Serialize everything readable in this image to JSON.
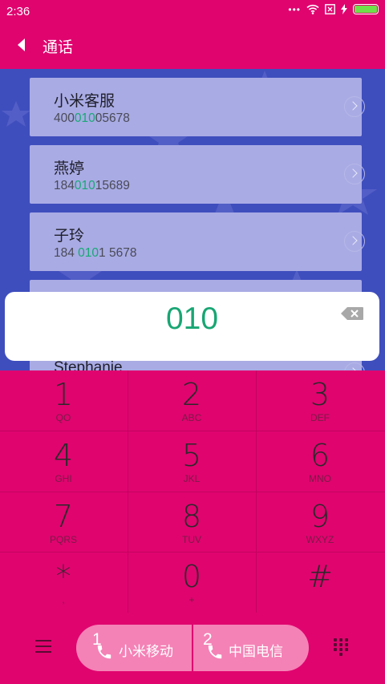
{
  "status": {
    "time": "2:36"
  },
  "header": {
    "title": "通话"
  },
  "contacts": [
    {
      "name": "小米客服",
      "num_pre": "400",
      "num_hl": "010",
      "num_post": "05678"
    },
    {
      "name": "燕婷",
      "num_pre": "184",
      "num_hl": "010",
      "num_post": "15689"
    },
    {
      "name": "子玲",
      "num_pre": "184 ",
      "num_hl": "010",
      "num_post": "1 5678"
    },
    {
      "name": "Stephanie"
    }
  ],
  "input": {
    "value": "010"
  },
  "keys": [
    {
      "digit": "1",
      "letters": "QO"
    },
    {
      "digit": "2",
      "letters": "ABC"
    },
    {
      "digit": "3",
      "letters": "DEF"
    },
    {
      "digit": "4",
      "letters": "GHI"
    },
    {
      "digit": "5",
      "letters": "JKL"
    },
    {
      "digit": "6",
      "letters": "MNO"
    },
    {
      "digit": "7",
      "letters": "PQRS"
    },
    {
      "digit": "8",
      "letters": "TUV"
    },
    {
      "digit": "9",
      "letters": "WXYZ"
    },
    {
      "digit": "*",
      "letters": ","
    },
    {
      "digit": "0",
      "letters": "+"
    },
    {
      "digit": "#",
      "letters": ""
    }
  ],
  "sims": [
    {
      "num": "1",
      "label": "小米移动"
    },
    {
      "num": "2",
      "label": "中国电信"
    }
  ],
  "colors": {
    "accent": "#e0046f",
    "highlight": "#17a974",
    "wallpaper": "#3f4ebd"
  },
  "icons": [
    "back-arrow-icon",
    "wifi-icon",
    "sim-error-icon",
    "charging-icon",
    "battery-icon",
    "chevron-right-icon",
    "backspace-icon",
    "menu-icon",
    "phone-icon",
    "dialpad-icon"
  ]
}
